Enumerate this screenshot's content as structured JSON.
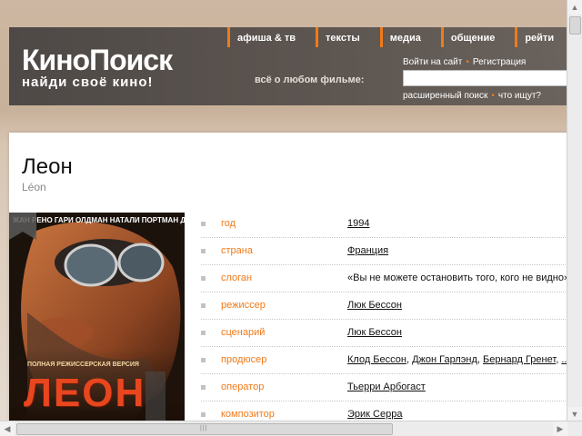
{
  "header": {
    "logo_title": "КиноПоиск",
    "logo_tagline": "найди своё кино!",
    "nav": [
      {
        "label": "афиша & тв"
      },
      {
        "label": "тексты"
      },
      {
        "label": "медиа"
      },
      {
        "label": "общение"
      },
      {
        "label": "рейти"
      }
    ],
    "login_link": "Войти на сайт",
    "register_link": "Регистрация",
    "search_label": "всё о любом фильме:",
    "search_value": "",
    "advanced_search_link": "расширенный поиск",
    "what_search_link": "что ищут?"
  },
  "movie": {
    "title": "Леон",
    "original_title": "Léon",
    "poster": {
      "cast_line": "ЖАН РЕНО  ГАРИ ОЛДМАН  НАТАЛИ ПОРТМАН  ДЭННИ АЙЕЛЛО",
      "edition_line": "ПОЛНАЯ РЕЖИССЕРСКАЯ ВЕРСИЯ",
      "title_text": "ЛЕОН"
    },
    "info": [
      {
        "label": "год",
        "values": [
          "1994"
        ],
        "link": true
      },
      {
        "label": "страна",
        "values": [
          "Франция"
        ],
        "link": true
      },
      {
        "label": "слоган",
        "values": [
          "«Вы не можете остановить того, кого не видно»"
        ],
        "link": false
      },
      {
        "label": "режиссер",
        "values": [
          "Люк Бессон"
        ],
        "link": true
      },
      {
        "label": "сценарий",
        "values": [
          "Люк Бессон"
        ],
        "link": true
      },
      {
        "label": "продюсер",
        "values": [
          "Клод Бессон",
          "Джон Гарлэнд",
          "Бернард Гренет",
          "..."
        ],
        "link": true
      },
      {
        "label": "оператор",
        "values": [
          "Тьерри Арбогаст"
        ],
        "link": true
      },
      {
        "label": "композитор",
        "values": [
          "Эрик Серра"
        ],
        "link": true
      }
    ]
  },
  "colors": {
    "accent": "#f07a1a",
    "header_bg": "#4e4946",
    "poster_title": "#e8461e"
  },
  "icons": {
    "bookmark": "bookmark-icon",
    "scroll_up": "arrow-up-icon",
    "scroll_down": "arrow-down-icon",
    "scroll_left": "arrow-left-icon",
    "scroll_right": "arrow-right-icon"
  }
}
